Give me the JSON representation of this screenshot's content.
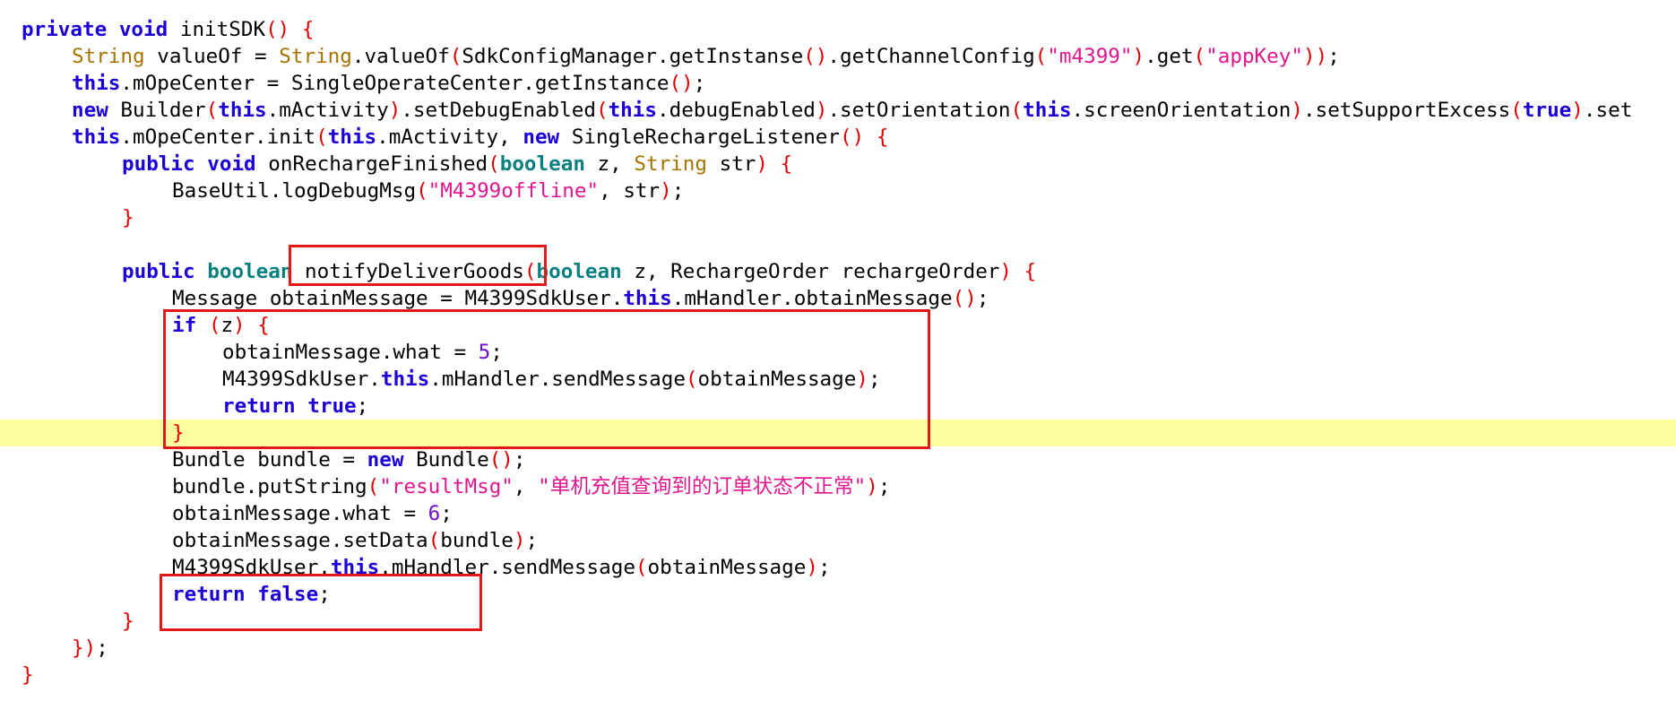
{
  "editor": {
    "highlighted_line": 15,
    "lines": [
      {
        "indent": 0,
        "tokens": [
          [
            "kw",
            "private"
          ],
          [
            "pl",
            " "
          ],
          [
            "kw",
            "void"
          ],
          [
            "pl",
            " initSDK"
          ],
          [
            "br",
            "()"
          ],
          [
            "pl",
            " "
          ],
          [
            "br",
            "{"
          ]
        ]
      },
      {
        "indent": 1,
        "tokens": [
          [
            "cl",
            "String"
          ],
          [
            "pl",
            " valueOf = "
          ],
          [
            "cl",
            "String"
          ],
          [
            "pl",
            ".valueOf"
          ],
          [
            "br",
            "("
          ],
          [
            "pl",
            "SdkConfigManager.getInstanse"
          ],
          [
            "br",
            "()"
          ],
          [
            "pl",
            ".getChannelConfig"
          ],
          [
            "br",
            "("
          ],
          [
            "st",
            "\"m4399\""
          ],
          [
            "br",
            ")"
          ],
          [
            "pl",
            ".get"
          ],
          [
            "br",
            "("
          ],
          [
            "st",
            "\"appKey\""
          ],
          [
            "br",
            "))"
          ],
          [
            "pl",
            ";"
          ]
        ]
      },
      {
        "indent": 1,
        "tokens": [
          [
            "kw",
            "this"
          ],
          [
            "pl",
            ".mOpeCenter = SingleOperateCenter.getInstance"
          ],
          [
            "br",
            "()"
          ],
          [
            "pl",
            ";"
          ]
        ]
      },
      {
        "indent": 1,
        "tokens": [
          [
            "kw",
            "new"
          ],
          [
            "pl",
            " Builder"
          ],
          [
            "br",
            "("
          ],
          [
            "kw",
            "this"
          ],
          [
            "pl",
            ".mActivity"
          ],
          [
            "br",
            ")"
          ],
          [
            "pl",
            ".setDebugEnabled"
          ],
          [
            "br",
            "("
          ],
          [
            "kw",
            "this"
          ],
          [
            "pl",
            ".debugEnabled"
          ],
          [
            "br",
            ")"
          ],
          [
            "pl",
            ".setOrientation"
          ],
          [
            "br",
            "("
          ],
          [
            "kw",
            "this"
          ],
          [
            "pl",
            ".screenOrientation"
          ],
          [
            "br",
            ")"
          ],
          [
            "pl",
            ".setSupportExcess"
          ],
          [
            "br",
            "("
          ],
          [
            "kw",
            "true"
          ],
          [
            "br",
            ")"
          ],
          [
            "pl",
            ".set"
          ]
        ]
      },
      {
        "indent": 1,
        "tokens": [
          [
            "kw",
            "this"
          ],
          [
            "pl",
            ".mOpeCenter.init"
          ],
          [
            "br",
            "("
          ],
          [
            "kw",
            "this"
          ],
          [
            "pl",
            ".mActivity, "
          ],
          [
            "kw",
            "new"
          ],
          [
            "pl",
            " SingleRechargeListener"
          ],
          [
            "br",
            "()"
          ],
          [
            "pl",
            " "
          ],
          [
            "br",
            "{"
          ]
        ]
      },
      {
        "indent": 2,
        "tokens": [
          [
            "kw",
            "public"
          ],
          [
            "pl",
            " "
          ],
          [
            "kw",
            "void"
          ],
          [
            "pl",
            " onRechargeFinished"
          ],
          [
            "br",
            "("
          ],
          [
            "ty",
            "boolean"
          ],
          [
            "pl",
            " z, "
          ],
          [
            "cl",
            "String"
          ],
          [
            "pl",
            " str"
          ],
          [
            "br",
            ")"
          ],
          [
            "pl",
            " "
          ],
          [
            "br",
            "{"
          ]
        ]
      },
      {
        "indent": 3,
        "tokens": [
          [
            "pl",
            "BaseUtil.logDebugMsg"
          ],
          [
            "br",
            "("
          ],
          [
            "st",
            "\"M4399offline\""
          ],
          [
            "pl",
            ", str"
          ],
          [
            "br",
            ")"
          ],
          [
            "pl",
            ";"
          ]
        ]
      },
      {
        "indent": 2,
        "tokens": [
          [
            "br",
            "}"
          ]
        ]
      },
      {
        "indent": 0,
        "tokens": []
      },
      {
        "indent": 2,
        "tokens": [
          [
            "kw",
            "public"
          ],
          [
            "pl",
            " "
          ],
          [
            "ty",
            "boolean"
          ],
          [
            "pl",
            " notifyDeliverGoods"
          ],
          [
            "br",
            "("
          ],
          [
            "ty",
            "boolean"
          ],
          [
            "pl",
            " z, RechargeOrder rechargeOrder"
          ],
          [
            "br",
            ")"
          ],
          [
            "pl",
            " "
          ],
          [
            "br",
            "{"
          ]
        ]
      },
      {
        "indent": 3,
        "tokens": [
          [
            "pl",
            "Message obtainMessage = M4399SdkUser."
          ],
          [
            "kw",
            "this"
          ],
          [
            "pl",
            ".mHandler.obtainMessage"
          ],
          [
            "br",
            "()"
          ],
          [
            "pl",
            ";"
          ]
        ]
      },
      {
        "indent": 3,
        "tokens": [
          [
            "kw",
            "if"
          ],
          [
            "pl",
            " "
          ],
          [
            "br",
            "("
          ],
          [
            "pl",
            "z"
          ],
          [
            "br",
            ")"
          ],
          [
            "pl",
            " "
          ],
          [
            "br",
            "{"
          ]
        ]
      },
      {
        "indent": 4,
        "tokens": [
          [
            "pl",
            "obtainMessage.what = "
          ],
          [
            "nm",
            "5"
          ],
          [
            "pl",
            ";"
          ]
        ]
      },
      {
        "indent": 4,
        "tokens": [
          [
            "pl",
            "M4399SdkUser."
          ],
          [
            "kw",
            "this"
          ],
          [
            "pl",
            ".mHandler.sendMessage"
          ],
          [
            "br",
            "("
          ],
          [
            "pl",
            "obtainMessage"
          ],
          [
            "br",
            ")"
          ],
          [
            "pl",
            ";"
          ]
        ]
      },
      {
        "indent": 4,
        "tokens": [
          [
            "kw",
            "return"
          ],
          [
            "pl",
            " "
          ],
          [
            "kw",
            "true"
          ],
          [
            "pl",
            ";"
          ]
        ]
      },
      {
        "indent": 3,
        "tokens": [
          [
            "br",
            "}"
          ]
        ]
      },
      {
        "indent": 3,
        "tokens": [
          [
            "pl",
            "Bundle bundle = "
          ],
          [
            "kw",
            "new"
          ],
          [
            "pl",
            " Bundle"
          ],
          [
            "br",
            "()"
          ],
          [
            "pl",
            ";"
          ]
        ]
      },
      {
        "indent": 3,
        "tokens": [
          [
            "pl",
            "bundle.putString"
          ],
          [
            "br",
            "("
          ],
          [
            "st",
            "\"resultMsg\""
          ],
          [
            "pl",
            ", "
          ],
          [
            "st",
            "\"单机充值查询到的订单状态不正常\""
          ],
          [
            "br",
            ")"
          ],
          [
            "pl",
            ";"
          ]
        ]
      },
      {
        "indent": 3,
        "tokens": [
          [
            "pl",
            "obtainMessage.what = "
          ],
          [
            "nm",
            "6"
          ],
          [
            "pl",
            ";"
          ]
        ]
      },
      {
        "indent": 3,
        "tokens": [
          [
            "pl",
            "obtainMessage.setData"
          ],
          [
            "br",
            "("
          ],
          [
            "pl",
            "bundle"
          ],
          [
            "br",
            ")"
          ],
          [
            "pl",
            ";"
          ]
        ]
      },
      {
        "indent": 3,
        "tokens": [
          [
            "pl",
            "M4399SdkUser."
          ],
          [
            "kw",
            "this"
          ],
          [
            "pl",
            ".mHandler.sendMessage"
          ],
          [
            "br",
            "("
          ],
          [
            "pl",
            "obtainMessage"
          ],
          [
            "br",
            ")"
          ],
          [
            "pl",
            ";"
          ]
        ]
      },
      {
        "indent": 3,
        "tokens": [
          [
            "kw",
            "return"
          ],
          [
            "pl",
            " "
          ],
          [
            "kw",
            "false"
          ],
          [
            "pl",
            ";"
          ]
        ]
      },
      {
        "indent": 2,
        "tokens": [
          [
            "br",
            "}"
          ]
        ]
      },
      {
        "indent": 1,
        "tokens": [
          [
            "br",
            "})"
          ],
          [
            "pl",
            ";"
          ]
        ]
      },
      {
        "indent": 0,
        "tokens": [
          [
            "br",
            "}"
          ]
        ]
      }
    ]
  },
  "colors": {
    "keyword": "#1a00d6",
    "primitive_type": "#0a7f7f",
    "class_name": "#a47300",
    "string": "#e0168d",
    "number": "#6a10c8",
    "bracket": "#e00000",
    "line_highlight": "#fdfd9f",
    "annotation_box": "#e01818"
  },
  "annotations": [
    {
      "label": "method-name-box",
      "target": "notifyDeliverGoods"
    },
    {
      "label": "if-block-box",
      "target": "if (z) { ... }"
    },
    {
      "label": "return-false-box",
      "target": "return false;"
    }
  ]
}
